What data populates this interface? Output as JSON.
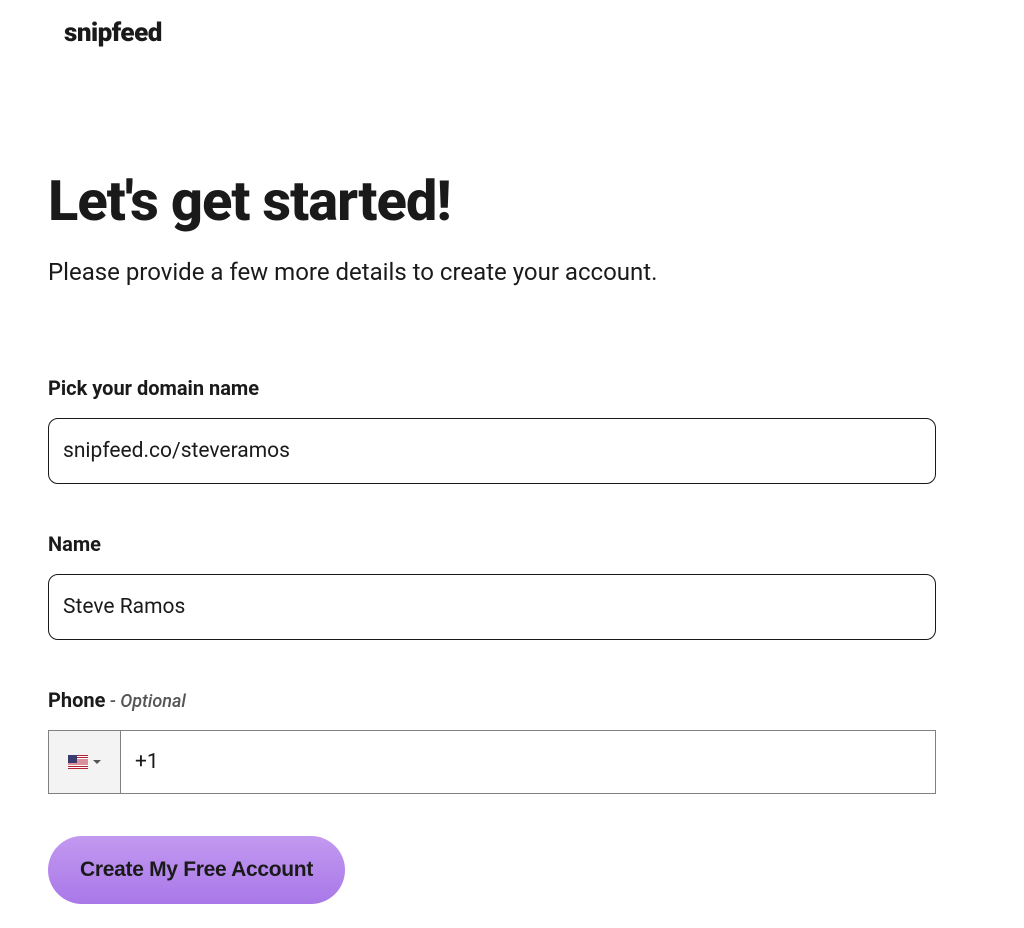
{
  "logo": "snipfeed",
  "heading": "Let's get started!",
  "subheading": "Please provide a few more details to create your account.",
  "form": {
    "domain": {
      "label": "Pick your domain name",
      "prefix": "snipfeed.co/",
      "value": "steveramos"
    },
    "name": {
      "label": "Name",
      "value": "Steve Ramos"
    },
    "phone": {
      "label": "Phone",
      "optional_suffix": " - Optional",
      "country_code": "US",
      "value": "+1"
    },
    "submit_label": "Create My Free Account"
  }
}
